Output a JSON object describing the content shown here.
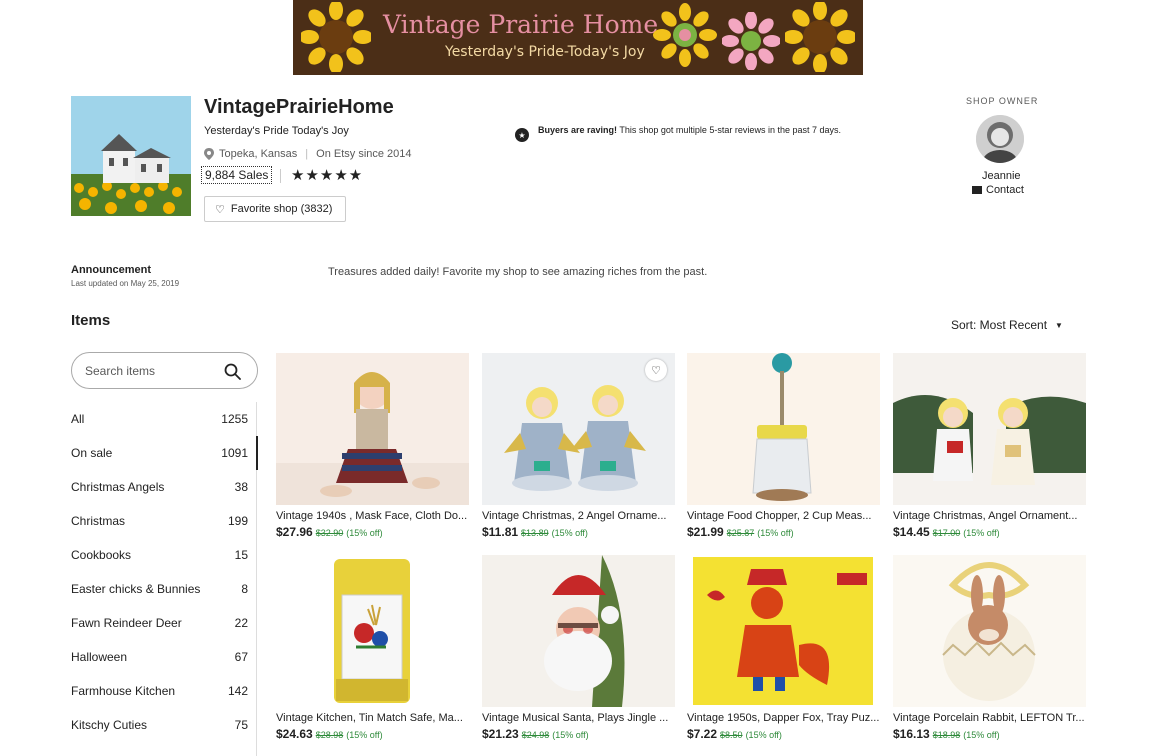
{
  "banner": {
    "title": "Vintage Prairie Home",
    "tagline": "Yesterday's Pride-Today's Joy"
  },
  "shop": {
    "name": "VintagePrairieHome",
    "tagline": "Yesterday's Pride Today's Joy",
    "location": "Topeka, Kansas",
    "since": "On Etsy since 2014",
    "sales": "9,884 Sales",
    "rating": 5,
    "stars": "★★★★★",
    "favorite_label": "Favorite shop (3832)"
  },
  "raving": {
    "bold": "Buyers are raving!",
    "text": " This shop got multiple 5-star reviews in the past 7 days."
  },
  "owner": {
    "label": "SHOP OWNER",
    "name": "Jeannie",
    "contact": "Contact"
  },
  "announcement": {
    "title": "Announcement",
    "updated": "Last updated on May 25, 2019",
    "text": "Treasures added daily! Favorite my shop to see amazing riches from the past."
  },
  "items": {
    "title": "Items",
    "sort_label": "Sort: Most Recent",
    "search_placeholder": "Search items"
  },
  "categories": [
    {
      "label": "All",
      "count": "1255"
    },
    {
      "label": "On sale",
      "count": "1091"
    },
    {
      "label": "Christmas Angels",
      "count": "38"
    },
    {
      "label": "Christmas",
      "count": "199"
    },
    {
      "label": "Cookbooks",
      "count": "15"
    },
    {
      "label": "Easter chicks & Bunnies",
      "count": "8"
    },
    {
      "label": "Fawn Reindeer Deer",
      "count": "22"
    },
    {
      "label": "Halloween",
      "count": "67"
    },
    {
      "label": "Farmhouse Kitchen",
      "count": "142"
    },
    {
      "label": "Kitschy Cuties",
      "count": "75"
    }
  ],
  "listings": [
    {
      "title": "Vintage 1940s , Mask Face, Cloth Do...",
      "price": "$27.96",
      "original": "$32.90",
      "discount": "(15% off)"
    },
    {
      "title": "Vintage Christmas, 2 Angel Orname...",
      "price": "$11.81",
      "original": "$13.89",
      "discount": "(15% off)"
    },
    {
      "title": "Vintage Food Chopper, 2 Cup Meas...",
      "price": "$21.99",
      "original": "$25.87",
      "discount": "(15% off)"
    },
    {
      "title": "Vintage Christmas, Angel Ornament...",
      "price": "$14.45",
      "original": "$17.00",
      "discount": "(15% off)"
    },
    {
      "title": "Vintage Kitchen, Tin Match Safe, Ma...",
      "price": "$24.63",
      "original": "$28.98",
      "discount": "(15% off)"
    },
    {
      "title": "Vintage Musical Santa, Plays Jingle ...",
      "price": "$21.23",
      "original": "$24.98",
      "discount": "(15% off)"
    },
    {
      "title": "Vintage 1950s, Dapper Fox, Tray Puz...",
      "price": "$7.22",
      "original": "$8.50",
      "discount": "(15% off)"
    },
    {
      "title": "Vintage Porcelain Rabbit, LEFTON Tr...",
      "price": "$16.13",
      "original": "$18.98",
      "discount": "(15% off)"
    }
  ],
  "colors": {
    "banner_bg": "#4b2e17",
    "banner_title": "#e58fa2",
    "sale_green": "#2e8a3a"
  }
}
